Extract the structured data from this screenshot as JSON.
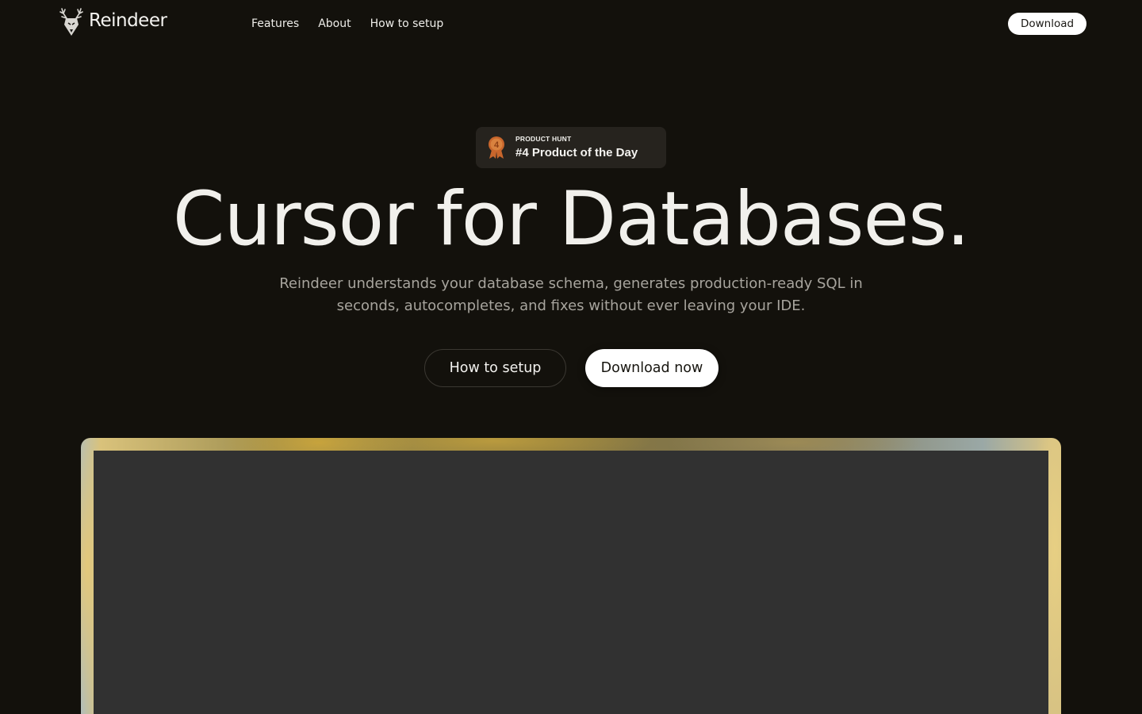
{
  "brand": {
    "name": "Reindeer",
    "logo_icon": "reindeer-head-icon"
  },
  "nav": {
    "items": [
      {
        "label": "Features"
      },
      {
        "label": "About"
      },
      {
        "label": "How to setup"
      }
    ],
    "download_label": "Download"
  },
  "badge": {
    "icon": "medal-icon",
    "medal_number": "4",
    "eyebrow": "PRODUCT HUNT",
    "title": "#4 Product of the Day"
  },
  "hero": {
    "title": "Cursor for Databases.",
    "subtitle": "Reindeer understands your database schema, generates production-ready SQL in seconds, autocompletes, and fixes without ever leaving your IDE.",
    "secondary_cta": "How to setup",
    "primary_cta": "Download now"
  },
  "colors": {
    "background": "#13110c",
    "badge_background": "#26231e",
    "medal": "#c8662c",
    "button_light": "#ffffff",
    "preview_screen": "#313131"
  }
}
